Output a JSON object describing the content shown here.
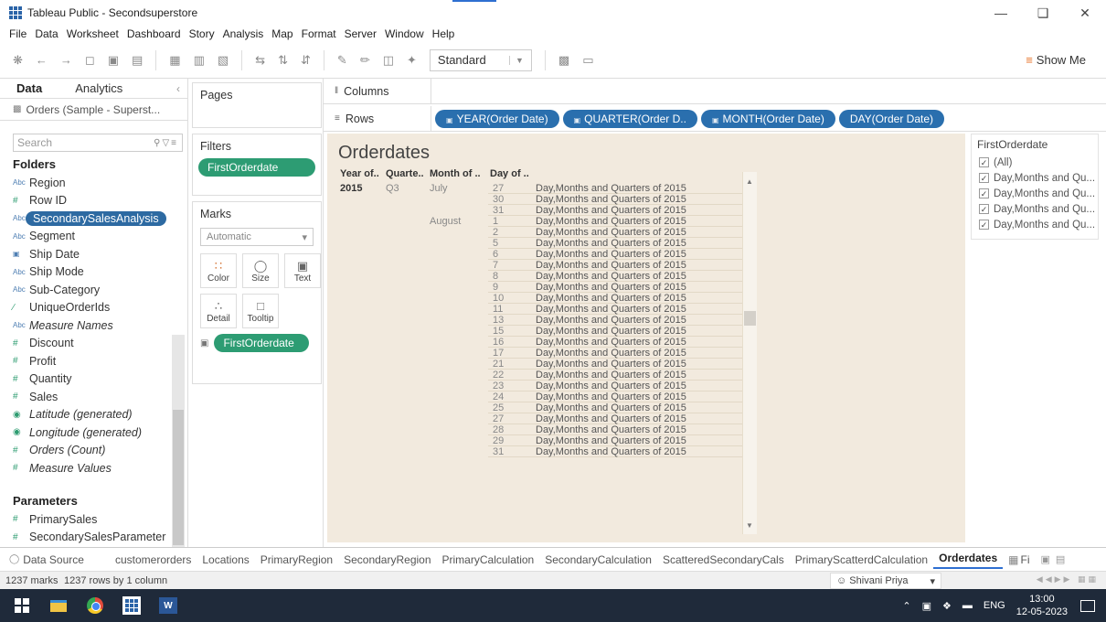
{
  "window": {
    "title": "Tableau Public - Secondsuperstore"
  },
  "menu": [
    "File",
    "Data",
    "Worksheet",
    "Dashboard",
    "Story",
    "Analysis",
    "Map",
    "Format",
    "Server",
    "Window",
    "Help"
  ],
  "toolbar": {
    "view_size": "Standard",
    "show_me": "Show Me"
  },
  "data_pane": {
    "tab_data": "Data",
    "tab_analytics": "Analytics",
    "source": "Orders (Sample - Superst...",
    "search_placeholder": "Search",
    "folders_heading": "Folders",
    "fields": [
      {
        "label": "Region",
        "type": "Abc"
      },
      {
        "label": "Row ID",
        "type": "#"
      },
      {
        "label": "SecondarySalesAnalysis",
        "type": "Abc",
        "selected": true
      },
      {
        "label": "Segment",
        "type": "Abc"
      },
      {
        "label": "Ship Date",
        "type": "date"
      },
      {
        "label": "Ship Mode",
        "type": "Abc"
      },
      {
        "label": "Sub-Category",
        "type": "Abc"
      },
      {
        "label": "UniqueOrderIds",
        "type": "calc"
      },
      {
        "label": "Measure Names",
        "type": "Abc",
        "italic": true
      },
      {
        "label": "Discount",
        "type": "#"
      },
      {
        "label": "Profit",
        "type": "#"
      },
      {
        "label": "Quantity",
        "type": "#"
      },
      {
        "label": "Sales",
        "type": "#"
      },
      {
        "label": "Latitude (generated)",
        "type": "geo",
        "italic": true
      },
      {
        "label": "Longitude (generated)",
        "type": "geo",
        "italic": true
      },
      {
        "label": "Orders (Count)",
        "type": "#",
        "italic": true
      },
      {
        "label": "Measure Values",
        "type": "#",
        "italic": true
      }
    ],
    "parameters_heading": "Parameters",
    "parameters": [
      "PrimarySales",
      "SecondarySalesParameter"
    ]
  },
  "cards": {
    "pages": "Pages",
    "filters": "Filters",
    "filter_pill": "FirstOrderdate",
    "marks": "Marks",
    "mark_type": "Automatic",
    "mark_buttons": [
      "Color",
      "Size",
      "Text",
      "Detail",
      "Tooltip"
    ],
    "marks_pill": "FirstOrderdate"
  },
  "shelves": {
    "columns": "Columns",
    "rows": "Rows",
    "row_pills": [
      "YEAR(Order Date)",
      "QUARTER(Order D..",
      "MONTH(Order Date)",
      "DAY(Order Date)"
    ]
  },
  "viz": {
    "title": "Orderdates",
    "headers": [
      "Year of..",
      "Quarte..",
      "Month of ..",
      "Day of .."
    ],
    "year": "2015",
    "quarter": "Q3",
    "months": [
      {
        "label": "July",
        "row": 0
      },
      {
        "label": "August",
        "row": 3
      }
    ],
    "rows": [
      {
        "day": "27",
        "value": "Day,Months and Quarters of 2015"
      },
      {
        "day": "30",
        "value": "Day,Months and Quarters of 2015"
      },
      {
        "day": "31",
        "value": "Day,Months and Quarters of 2015"
      },
      {
        "day": "1",
        "value": "Day,Months and Quarters of 2015"
      },
      {
        "day": "2",
        "value": "Day,Months and Quarters of 2015"
      },
      {
        "day": "5",
        "value": "Day,Months and Quarters of 2015"
      },
      {
        "day": "6",
        "value": "Day,Months and Quarters of 2015"
      },
      {
        "day": "7",
        "value": "Day,Months and Quarters of 2015"
      },
      {
        "day": "8",
        "value": "Day,Months and Quarters of 2015"
      },
      {
        "day": "9",
        "value": "Day,Months and Quarters of 2015"
      },
      {
        "day": "10",
        "value": "Day,Months and Quarters of 2015"
      },
      {
        "day": "11",
        "value": "Day,Months and Quarters of 2015"
      },
      {
        "day": "13",
        "value": "Day,Months and Quarters of 2015"
      },
      {
        "day": "15",
        "value": "Day,Months and Quarters of 2015"
      },
      {
        "day": "16",
        "value": "Day,Months and Quarters of 2015"
      },
      {
        "day": "17",
        "value": "Day,Months and Quarters of 2015"
      },
      {
        "day": "21",
        "value": "Day,Months and Quarters of 2015"
      },
      {
        "day": "22",
        "value": "Day,Months and Quarters of 2015"
      },
      {
        "day": "23",
        "value": "Day,Months and Quarters of 2015"
      },
      {
        "day": "24",
        "value": "Day,Months and Quarters of 2015"
      },
      {
        "day": "25",
        "value": "Day,Months and Quarters of 2015"
      },
      {
        "day": "27",
        "value": "Day,Months and Quarters of 2015"
      },
      {
        "day": "28",
        "value": "Day,Months and Quarters of 2015"
      },
      {
        "day": "29",
        "value": "Day,Months and Quarters of 2015"
      },
      {
        "day": "31",
        "value": "Day,Months and Quarters of 2015"
      }
    ]
  },
  "filter_panel": {
    "title": "FirstOrderdate",
    "options": [
      "(All)",
      "Day,Months and Qu...",
      "Day,Months and Qu...",
      "Day,Months and Qu...",
      "Day,Months and Qu..."
    ]
  },
  "sheet_tabs": {
    "data_source": "Data Source",
    "sheets": [
      "customerorders",
      "Locations",
      "PrimaryRegion",
      "SecondaryRegion",
      "PrimaryCalculation",
      "SecondaryCalculation",
      "ScatteredSecondaryCals",
      "PrimaryScatterdCalculation",
      "Orderdates",
      "Fi"
    ],
    "active": "Orderdates"
  },
  "status": {
    "marks": "1237 marks",
    "rows": "1237 rows by 1 column",
    "user": "Shivani Priya"
  },
  "taskbar": {
    "lang": "ENG",
    "time": "13:00",
    "date": "12-05-2023"
  },
  "colors": {
    "blue_pill": "#2a6fae",
    "green_pill": "#2d9c73",
    "viz_bg": "#f2eade"
  }
}
